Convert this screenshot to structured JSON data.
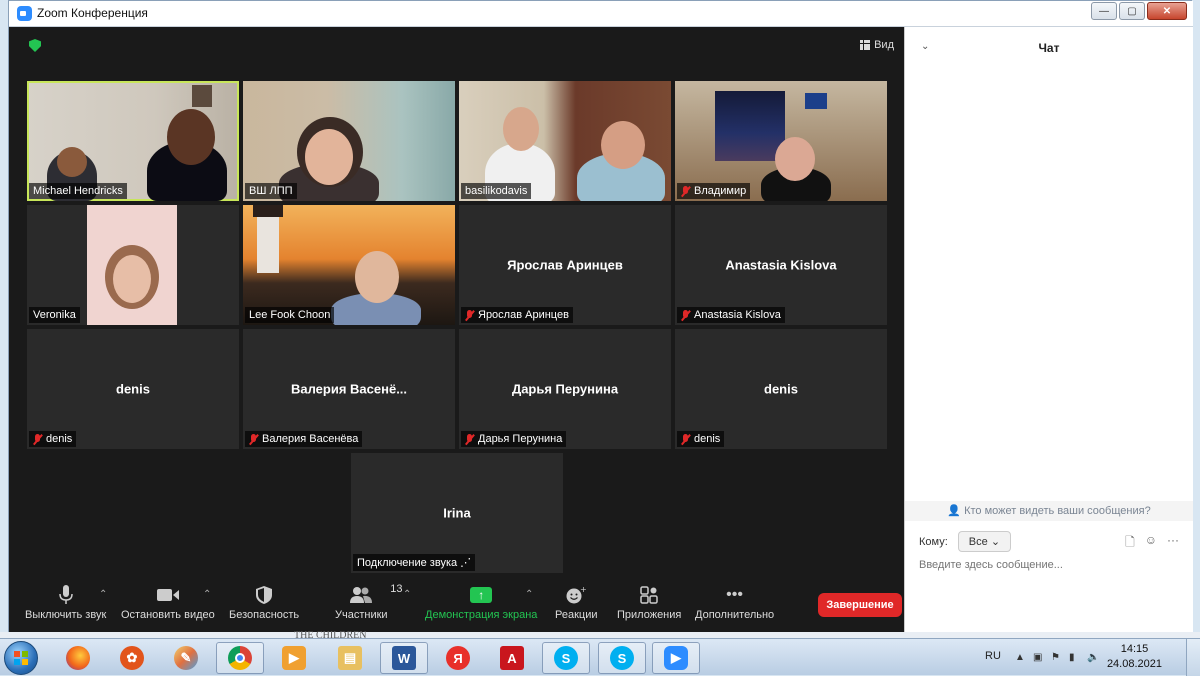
{
  "window": {
    "title": "Zoom Конференция",
    "minimize": "—",
    "maximize": "▢",
    "close": "✕"
  },
  "meeting": {
    "view_label": "Вид",
    "tiles": [
      {
        "name": "Michael Hendricks",
        "muted": false,
        "video": true,
        "active": true
      },
      {
        "name": "ВШ ЛПП",
        "muted": false,
        "video": true
      },
      {
        "name": "basilikodavis",
        "muted": false,
        "video": true
      },
      {
        "name": "Владимир",
        "muted": true,
        "video": true
      },
      {
        "name": "Veronika",
        "muted": false,
        "video": true
      },
      {
        "name": "Lee Fook Choon",
        "muted": false,
        "video": true
      },
      {
        "name": "Ярослав Аринцев",
        "display": "Ярослав Аринцев",
        "muted": true,
        "video": false
      },
      {
        "name": "Anastasia Kislova",
        "display": "Anastasia Kislova",
        "muted": true,
        "video": false
      },
      {
        "name": "denis",
        "display": "denis",
        "muted": true,
        "video": false
      },
      {
        "name": "Валерия Васенёва",
        "display": "Валерия  Васенё...",
        "muted": true,
        "video": false
      },
      {
        "name": "Дарья Перунина",
        "display": "Дарья Перунина",
        "muted": true,
        "video": false
      },
      {
        "name": "denis",
        "display": "denis",
        "muted": true,
        "video": false
      },
      {
        "name": "Подключение звука ⋰",
        "display": "Irina",
        "muted": false,
        "video": false
      }
    ]
  },
  "toolbar": {
    "mute": "Выключить звук",
    "video": "Остановить видео",
    "security": "Безопасность",
    "participants": "Участники",
    "participants_count": "13",
    "share": "Демонстрация экрана",
    "reactions": "Реакции",
    "apps": "Приложения",
    "more": "Дополнительно",
    "end": "Завершение"
  },
  "chat": {
    "title": "Чат",
    "who_can_see": "Кто может видеть ваши сообщения?",
    "to_label": "Кому:",
    "to_value": "Все",
    "placeholder": "Введите здесь сообщение..."
  },
  "desktop_text": "THE CHILDREN",
  "taskbar": {
    "lang": "RU",
    "time": "14:15",
    "date": "24.08.2021"
  },
  "colors": {
    "zoom_blue": "#2d8cff",
    "end_red": "#e02828",
    "share_green": "#23c552",
    "active_border": "#c8e65a"
  }
}
